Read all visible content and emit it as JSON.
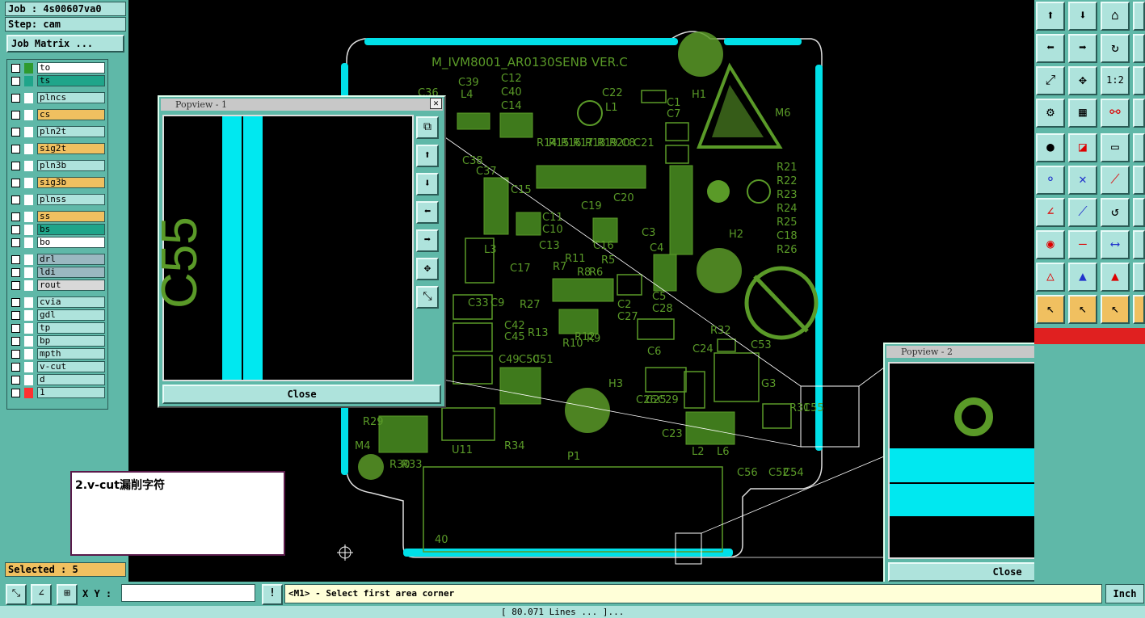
{
  "job": {
    "job_label": "Job : 4s00607va0",
    "step_label": "Step: cam",
    "matrix_button": "Job Matrix ..."
  },
  "layers": [
    {
      "name": "to",
      "color": "#ffffff",
      "chip": "#2e9a2e"
    },
    {
      "name": "ts",
      "color": "#1fa58a",
      "chip": "#1fa58a"
    },
    {
      "name": "plncs",
      "color": "#aee3dc",
      "chip": "#ffffff"
    },
    {
      "name": "cs",
      "color": "#f0c060",
      "chip": "#ffffff"
    },
    {
      "name": "pln2t",
      "color": "#aee3dc",
      "chip": "#ffffff"
    },
    {
      "name": "sig2t",
      "color": "#f0c060",
      "chip": "#ffffff"
    },
    {
      "name": "pln3b",
      "color": "#aee3dc",
      "chip": "#ffffff"
    },
    {
      "name": "sig3b",
      "color": "#f0c060",
      "chip": "#ffffff"
    },
    {
      "name": "plnss",
      "color": "#aee3dc",
      "chip": "#ffffff"
    },
    {
      "name": "ss",
      "color": "#f0c060",
      "chip": "#ffffff"
    },
    {
      "name": "bs",
      "color": "#1fa58a",
      "chip": "#ffffff"
    },
    {
      "name": "bo",
      "color": "#ffffff",
      "chip": "#ffffff"
    },
    {
      "name": "drl",
      "color": "#9ab8c0",
      "chip": "#ffffff"
    },
    {
      "name": "ldi",
      "color": "#9ab8c0",
      "chip": "#ffffff"
    },
    {
      "name": "rout",
      "color": "#d8d8d8",
      "chip": "#ffffff"
    },
    {
      "name": "cvia",
      "color": "#aee3dc",
      "chip": "#ffffff"
    },
    {
      "name": "gdl",
      "color": "#aee3dc",
      "chip": "#ffffff"
    },
    {
      "name": "tp",
      "color": "#aee3dc",
      "chip": "#ffffff"
    },
    {
      "name": "bp",
      "color": "#aee3dc",
      "chip": "#ffffff"
    },
    {
      "name": "mpth",
      "color": "#aee3dc",
      "chip": "#ffffff"
    },
    {
      "name": "v-cut",
      "color": "#aee3dc",
      "chip": "#ffffff"
    },
    {
      "name": "d",
      "color": "#aee3dc",
      "chip": "#ffffff"
    },
    {
      "name": "1",
      "color": "#aee3dc",
      "chip": "#ff3030"
    }
  ],
  "selected": "Selected : 5",
  "board": {
    "title": "M_IVM8001_AR0130SENB VER.C",
    "labels": [
      "C36",
      "C39",
      "L4",
      "C12",
      "C40",
      "C14",
      "C22",
      "L1",
      "C1",
      "C7",
      "H1",
      "M6",
      "C38",
      "C37",
      "R14",
      "R15",
      "R16",
      "R17",
      "R18",
      "R19",
      "R20",
      "C8",
      "C21",
      "R21",
      "R22",
      "R23",
      "R24",
      "R25",
      "C18",
      "R26",
      "C15",
      "C11",
      "C10",
      "C19",
      "C20",
      "C3",
      "H2",
      "L3",
      "C17",
      "C13",
      "R7",
      "R11",
      "R8",
      "R6",
      "R5",
      "C16",
      "C4",
      "C5",
      "C28",
      "C33",
      "C9",
      "R27",
      "C2",
      "C27",
      "C42",
      "C45",
      "R13",
      "R10",
      "R12",
      "R9",
      "C6",
      "R32",
      "C53",
      "C24",
      "C49",
      "C50",
      "C51",
      "G3",
      "H3",
      "C26",
      "C25",
      "C29",
      "C23",
      "L2",
      "L6",
      "R31",
      "C55",
      "R29",
      "M4",
      "U11",
      "R34",
      "P1",
      "R30",
      "R33",
      "C56",
      "C52",
      "C54",
      "40"
    ]
  },
  "popview1": {
    "title": "Popview - 1",
    "close_label": "Close",
    "text": "C55"
  },
  "popview2": {
    "title": "Popview - 2",
    "close_label": "Close"
  },
  "note": "2.v-cut漏削字符",
  "bottom": {
    "xy_label": "X Y :",
    "xy_value": "",
    "prompt": "<M1> - Select first area corner",
    "units": "Inch",
    "status": "[    80.071 Lines       ...     ]..."
  }
}
